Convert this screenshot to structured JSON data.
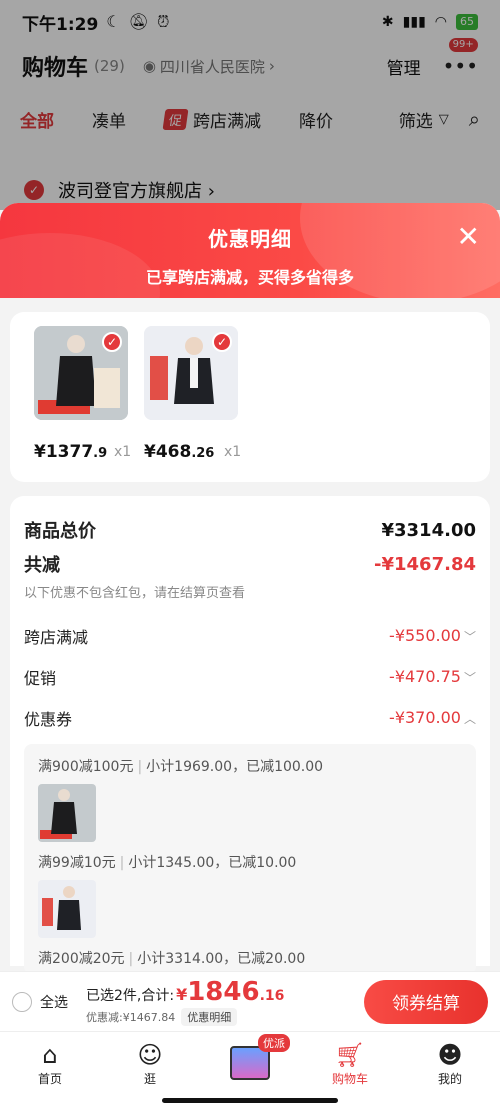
{
  "status_bar": {
    "time": "下午1:29",
    "battery": "65"
  },
  "cart_header": {
    "title": "购物车",
    "count": "(29)",
    "location": "四川省人民医院",
    "manage": "管理",
    "more_badge": "99+"
  },
  "tabs": [
    {
      "label": "全部",
      "active": true
    },
    {
      "label": "凑单"
    },
    {
      "label": "跨店满减",
      "tag": "促"
    },
    {
      "label": "降价"
    },
    {
      "label": "筛选"
    }
  ],
  "store": {
    "name": "波司登官方旗舰店 ›"
  },
  "sheet": {
    "title": "优惠明细",
    "subtitle": "已享跨店满减，买得多省得多",
    "products": [
      {
        "price_int": "¥1377",
        "price_dec": ".9",
        "qty": "x1"
      },
      {
        "price_int": "¥468",
        "price_dec": ".26",
        "qty": "x1"
      }
    ],
    "total_label": "商品总价",
    "total_value": "¥3314.00",
    "reduce_label": "共减",
    "reduce_value": "-¥1467.84",
    "note": "以下优惠不包含红包，请在结算页查看",
    "items": [
      {
        "label": "跨店满减",
        "value": "-¥550.00"
      },
      {
        "label": "促销",
        "value": "-¥470.75"
      },
      {
        "label": "优惠券",
        "value": "-¥370.00"
      }
    ],
    "coupon_lines": [
      {
        "rule": "满900减100元",
        "detail": "小计1969.00，已减100.00"
      },
      {
        "rule": "满99减10元",
        "detail": "小计1345.00，已减10.00"
      },
      {
        "rule": "满200减20元",
        "detail": "小计3314.00，已减20.00"
      }
    ]
  },
  "checkout": {
    "select_all": "全选",
    "selected": "已选2件,合计:",
    "amount_cur": "¥",
    "amount_int": "1846",
    "amount_dec": ".16",
    "discount": "优惠减:¥1467.84",
    "detail_btn": "优惠明细",
    "button": "领券结算"
  },
  "nav": [
    {
      "label": "首页",
      "icon": "home-icon"
    },
    {
      "label": "逛",
      "icon": "browse-icon"
    },
    {
      "label": "",
      "icon": "promo-icon",
      "badge": "优派"
    },
    {
      "label": "购物车",
      "icon": "cart-icon",
      "active": true
    },
    {
      "label": "我的",
      "icon": "profile-icon"
    }
  ],
  "colors": {
    "accent": "#e4393c"
  }
}
